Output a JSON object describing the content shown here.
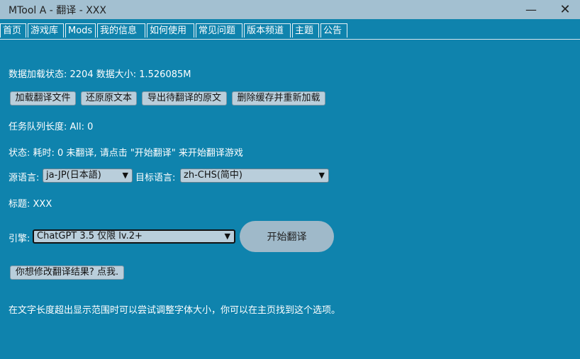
{
  "window": {
    "title": "MTool A - 翻译 - XXX",
    "minimize_glyph": "—",
    "close_glyph": "✕"
  },
  "tabs": [
    {
      "label": "首页"
    },
    {
      "label": "游戏库"
    },
    {
      "label": "Mods"
    },
    {
      "label": "我的信息"
    },
    {
      "label": "如何使用"
    },
    {
      "label": "常见问题"
    },
    {
      "label": "版本频道"
    },
    {
      "label": "主题"
    },
    {
      "label": "公告"
    }
  ],
  "status": {
    "data_load": "数据加载状态: 2204 数据大小: 1.526085M",
    "queue": "任务队列长度: All: 0",
    "state": "状态: 耗时: 0 未翻译, 请点击 \"开始翻译\" 来开始翻译游戏",
    "title_line": "标题: XXX",
    "hint": "在文字长度超出显示范围时可以尝试调整字体大小，你可以在主页找到这个选项。"
  },
  "actions": {
    "load": "加载翻译文件",
    "restore": "还原原文本",
    "export": "导出待翻译的原文",
    "clear": "删除缓存并重新加载",
    "edit": "你想修改翻译结果? 点我."
  },
  "language": {
    "source_label": "源语言:",
    "source_value": "ja-JP(日本語)",
    "target_label": "目标语言:",
    "target_value": "zh-CHS(简中)"
  },
  "engine": {
    "label": "引擎:",
    "value": "ChatGPT 3.5 仅限 lv.2+",
    "start": "开始翻译"
  },
  "colors": {
    "background": "#0f83ad",
    "titlebar": "#a3c0d1",
    "button": "#b9cedb"
  }
}
